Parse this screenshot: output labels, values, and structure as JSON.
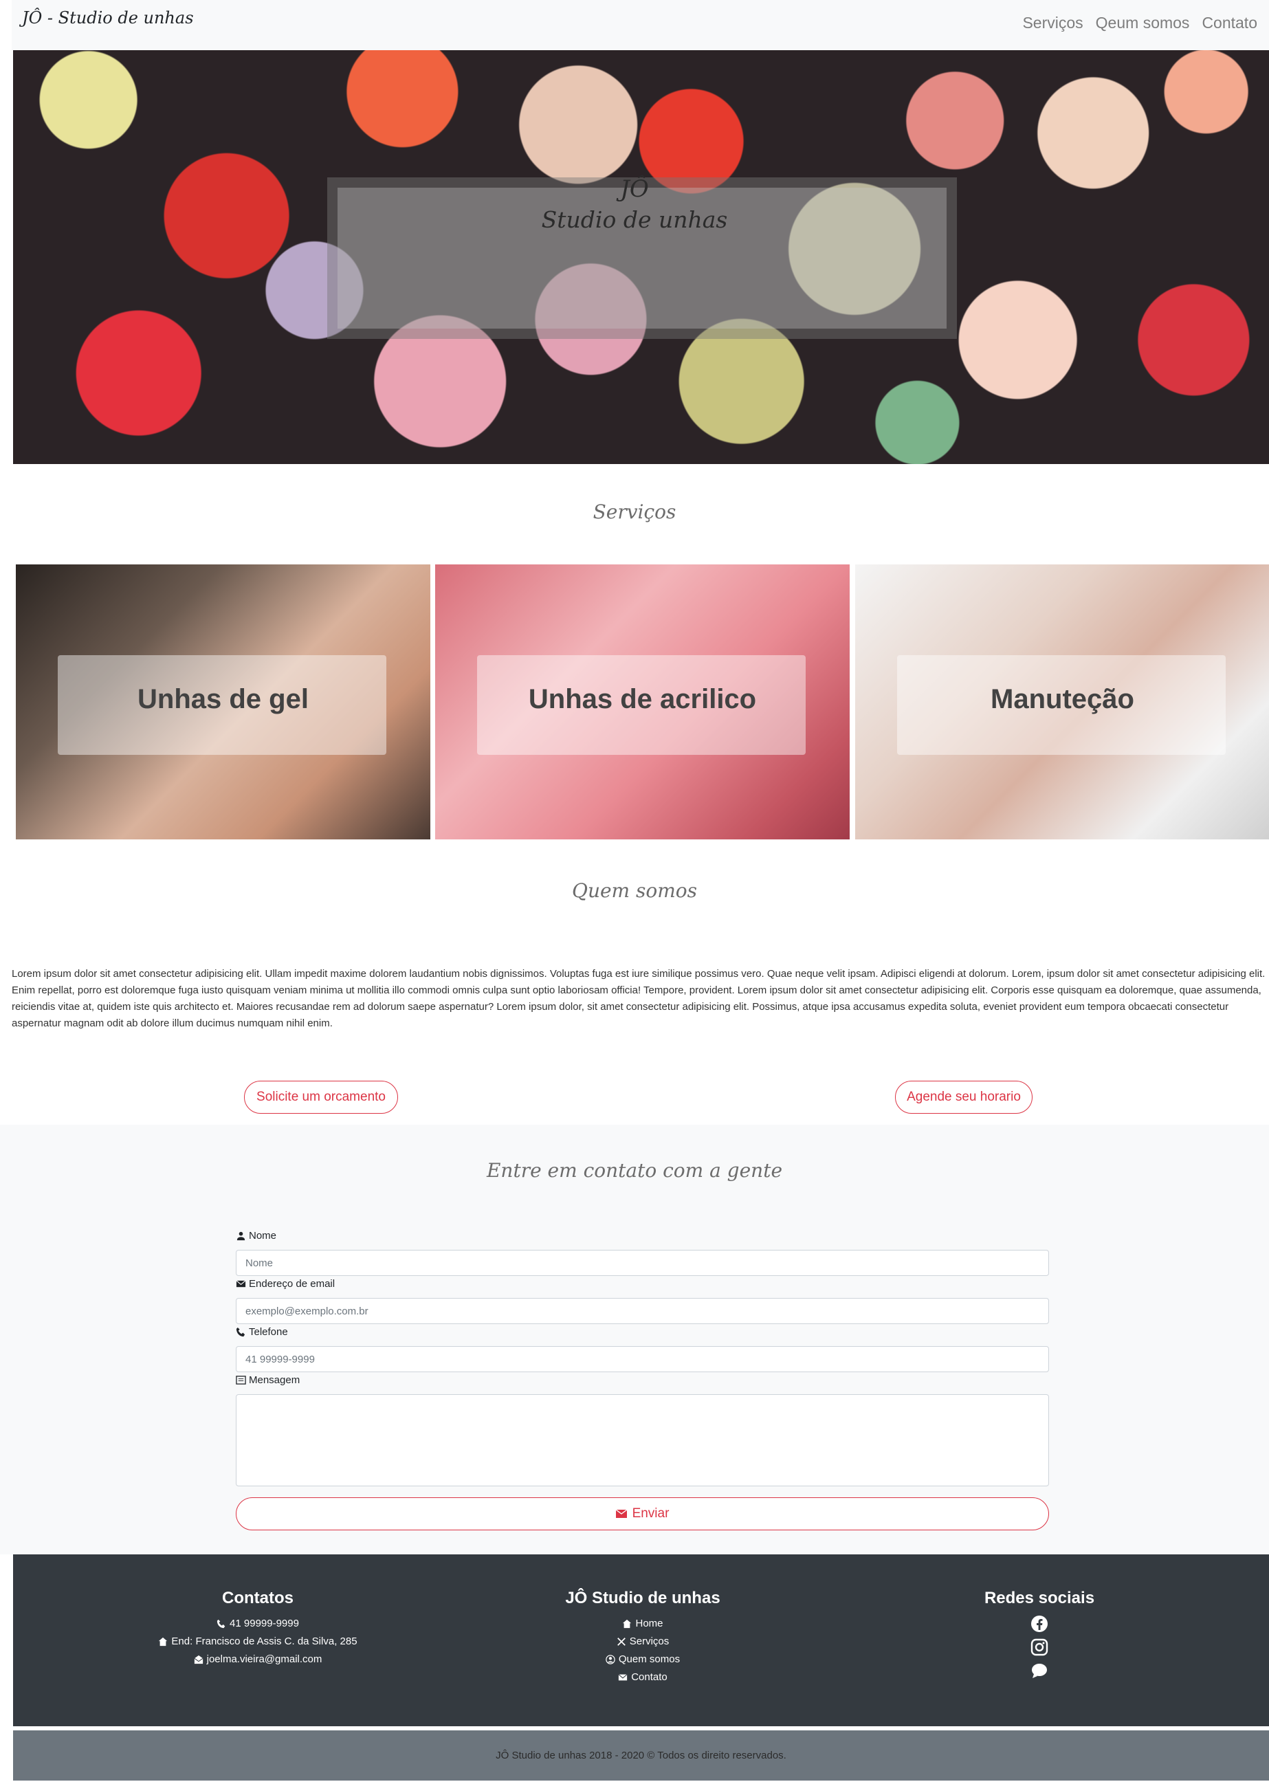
{
  "navbar": {
    "brand": "JÔ - Studio de unhas",
    "links": [
      "Serviços",
      "Qeum somos",
      "Contato"
    ]
  },
  "hero": {
    "line1": "JÔ",
    "line2": "Studio de unhas"
  },
  "services": {
    "title": "Serviços",
    "cards": [
      "Unhas de gel",
      "Unhas de acrilico",
      "Manuteção"
    ]
  },
  "about": {
    "title": "Quem somos",
    "text": "Lorem ipsum dolor sit amet consectetur adipisicing elit. Ullam impedit maxime dolorem laudantium nobis dignissimos. Voluptas fuga est iure similique possimus vero. Quae neque velit ipsam. Adipisci eligendi at dolorum. Lorem, ipsum dolor sit amet consectetur adipisicing elit. Enim repellat, porro est doloremque fuga iusto quisquam veniam minima ut mollitia illo commodi omnis culpa sunt optio laboriosam officia! Tempore, provident. Lorem ipsum dolor sit amet consectetur adipisicing elit. Corporis esse quisquam ea doloremque, quae assumenda, reiciendis vitae at, quidem iste quis architecto et. Maiores recusandae rem ad dolorum saepe aspernatur? Lorem ipsum dolor, sit amet consectetur adipisicing elit. Possimus, atque ipsa accusamus expedita soluta, eveniet provident eum tempora obcaecati consectetur aspernatur magnam odit ab dolore illum ducimus numquam nihil enim.",
    "btn_orcamento": "Solicite um orcamento",
    "btn_agende": "Agende seu horario"
  },
  "contact": {
    "title": "Entre em contato com a gente",
    "name_label": "Nome",
    "name_placeholder": "Nome",
    "email_label": "Endereço de email",
    "email_placeholder": "exemplo@exemplo.com.br",
    "phone_label": "Telefone",
    "phone_placeholder": "41 99999-9999",
    "message_label": "Mensagem",
    "send_label": "Enviar"
  },
  "footer": {
    "contacts_title": "Contatos",
    "phone": "41 99999-9999",
    "address": "End: Francisco de Assis C. da Silva, 285",
    "email": "joelma.vieira@gmail.com",
    "studio_title": "JÔ Studio de unhas",
    "links": [
      "Home",
      "Serviços",
      "Quem somos",
      "Contato"
    ],
    "social_title": "Redes sociais",
    "social_icons": [
      "facebook-icon",
      "instagram-icon",
      "chat-icon"
    ],
    "copyright": "JÔ Studio de unhas 2018 - 2020 © Todos os direito reservados."
  },
  "colors": {
    "accent": "#dc3545",
    "footer_bg": "#343a40",
    "bottom_bar_bg": "#6c757d",
    "light_bg": "#f8f9fa"
  }
}
